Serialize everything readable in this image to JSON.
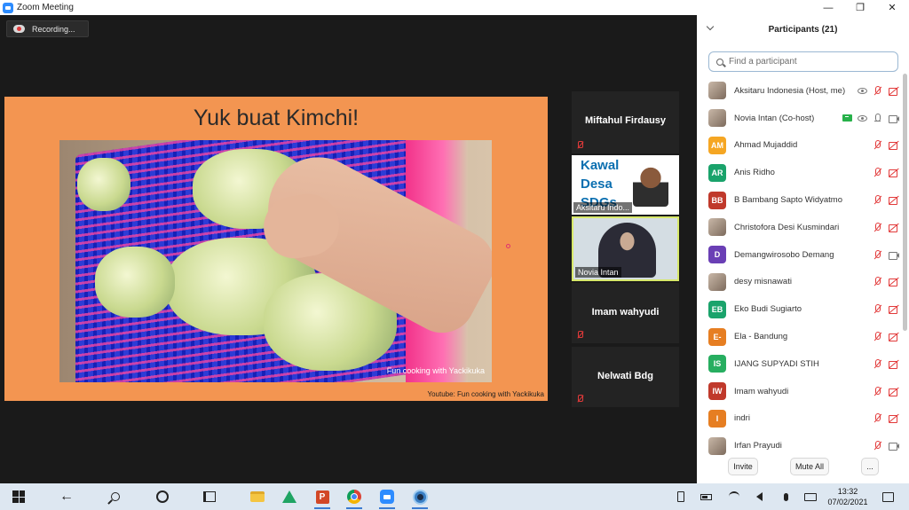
{
  "window": {
    "title": "Zoom Meeting"
  },
  "meeting": {
    "recording_label": "Recording...",
    "slide": {
      "title": "Yuk buat Kimchi!",
      "video_watermark": "Fun cooking with Yackikuka",
      "source": "Youtube: Fun cooking with Yackikuka"
    },
    "tiles": [
      {
        "name": "Miftahul Firdausy",
        "mic": "muted"
      },
      {
        "name": "Aksitaru Indo...",
        "banner": "Kawal Desa SDGs",
        "mic": "muted"
      },
      {
        "name": "Novia Intan",
        "active_speaker": true
      },
      {
        "name": "Imam wahyudi",
        "mic": "muted"
      },
      {
        "name": "Nelwati  Bdg",
        "mic": "muted"
      }
    ]
  },
  "participants": {
    "header": "Participants (21)",
    "search_placeholder": "Find a participant",
    "list": [
      {
        "initials": "",
        "name": "Aksitaru Indonesia (Host, me)",
        "color": "#cfcfcf",
        "photo": true,
        "extra": "eye",
        "mic": "muted",
        "cam": "off"
      },
      {
        "initials": "",
        "name": "Novia Intan (Co-host)",
        "color": "#cfcfcf",
        "photo": true,
        "extra": "share-eye",
        "mic": "on",
        "cam": "on"
      },
      {
        "initials": "AM",
        "name": "Ahmad Mujaddid",
        "color": "#f5a623",
        "mic": "muted",
        "cam": "off"
      },
      {
        "initials": "AR",
        "name": "Anis Ridho",
        "color": "#1aa36b",
        "mic": "muted",
        "cam": "off"
      },
      {
        "initials": "BB",
        "name": "B Bambang Sapto Widyatmo",
        "color": "#c0392b",
        "mic": "muted",
        "cam": "off"
      },
      {
        "initials": "",
        "name": "Christofora Desi Kusmindari",
        "color": "#cfcfcf",
        "photo": true,
        "mic": "muted",
        "cam": "off"
      },
      {
        "initials": "D",
        "name": "Demangwirosobo Demang",
        "color": "#6a3fb5",
        "mic": "muted",
        "cam": "on"
      },
      {
        "initials": "",
        "name": "desy misnawati",
        "color": "#cfcfcf",
        "photo": true,
        "mic": "muted",
        "cam": "off"
      },
      {
        "initials": "EB",
        "name": "Eko Budi Sugiarto",
        "color": "#1aa36b",
        "mic": "muted",
        "cam": "off"
      },
      {
        "initials": "E-",
        "name": "Ela - Bandung",
        "color": "#e67e22",
        "mic": "muted",
        "cam": "off"
      },
      {
        "initials": "IS",
        "name": "IJANG SUPYADI STIH",
        "color": "#27ae60",
        "mic": "muted",
        "cam": "off"
      },
      {
        "initials": "IW",
        "name": "Imam wahyudi",
        "color": "#c0392b",
        "mic": "muted",
        "cam": "off"
      },
      {
        "initials": "I",
        "name": "indri",
        "color": "#e67e22",
        "mic": "muted",
        "cam": "off"
      },
      {
        "initials": "",
        "name": "Irfan Prayudi",
        "color": "#cfcfcf",
        "photo": true,
        "mic": "muted",
        "cam": "on"
      }
    ],
    "footer": {
      "invite": "Invite",
      "mute_all": "Mute All",
      "more": "..."
    }
  },
  "taskbar": {
    "time": "13:32",
    "date": "07/02/2021",
    "apps": [
      "windows-start",
      "back-arrow",
      "search",
      "cortana",
      "task-view",
      "file-explorer",
      "google-drive",
      "powerpoint",
      "chrome",
      "zoom",
      "camera"
    ]
  }
}
